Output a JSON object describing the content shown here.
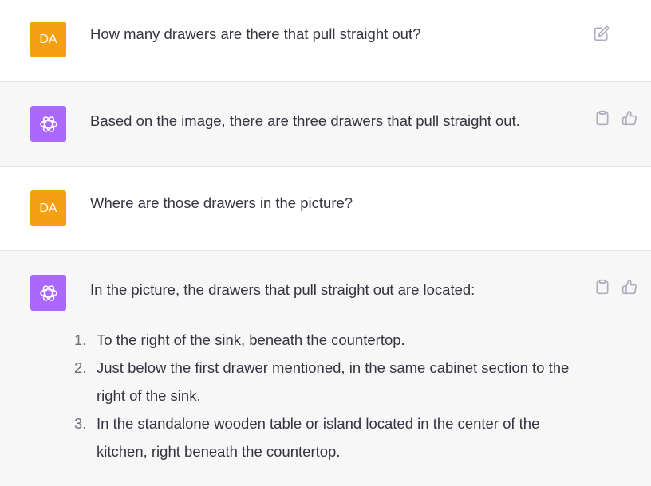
{
  "conversation": {
    "turns": [
      {
        "role": "user",
        "avatar_text": "DA",
        "text": "How many drawers are there that pull straight out?"
      },
      {
        "role": "assistant",
        "text": "Based on the image, there are three drawers that pull straight out."
      },
      {
        "role": "user",
        "avatar_text": "DA",
        "text": "Where are those drawers in the picture?"
      },
      {
        "role": "assistant",
        "text": "In the picture, the drawers that pull straight out are located:",
        "list": [
          {
            "num": "1.",
            "text": "To the right of the sink, beneath the countertop."
          },
          {
            "num": "2.",
            "text": "Just below the first drawer mentioned, in the same cabinet section to the right of the sink."
          },
          {
            "num": "3.",
            "text": "In the standalone wooden table or island located in the center of the kitchen, right beneath the countertop."
          }
        ]
      }
    ]
  },
  "icons": {
    "edit": "edit-icon",
    "copy": "clipboard-icon",
    "thumbs_up": "thumbs-up-icon",
    "assistant_logo": "openai-logo-icon"
  },
  "colors": {
    "user_avatar": "#f4a012",
    "assistant_avatar": "#ab68ff",
    "assistant_background": "#f7f7f8"
  }
}
